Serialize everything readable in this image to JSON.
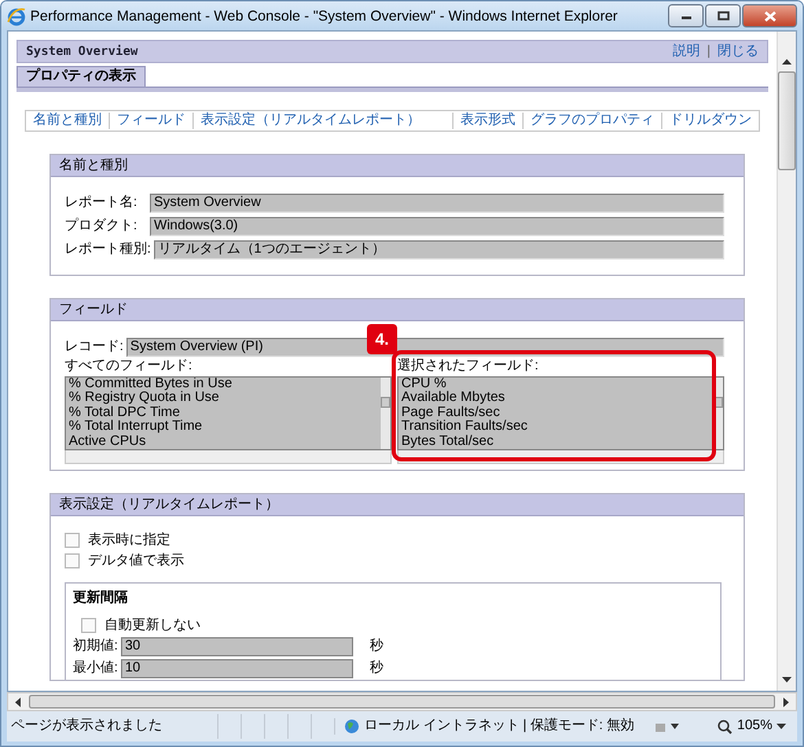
{
  "window": {
    "title": "Performance Management - Web Console - \"System Overview\" - Windows Internet Explorer"
  },
  "page_header": {
    "title": "System Overview",
    "links": [
      "説明",
      "閉じる"
    ],
    "link_separator": "|"
  },
  "tabs": [
    {
      "label": "プロパティの表示",
      "selected": true
    }
  ],
  "nav_links": [
    "名前と種別",
    "フィールド",
    "表示設定（リアルタイムレポート）",
    "表示形式",
    "グラフのプロパティ",
    "ドリルダウン"
  ],
  "sections": [
    {
      "kind": "form",
      "title": "名前と種別",
      "fields": [
        {
          "label": "レポート名:",
          "value": "System Overview"
        },
        {
          "label": "プロダクト:",
          "value": "Windows(3.0)"
        },
        {
          "label": "レポート種別:",
          "value": "リアルタイム（1つのエージェント）"
        }
      ]
    },
    {
      "kind": "fields",
      "title": "フィールド",
      "record": {
        "label": "レコード:",
        "value": "System Overview (PI)"
      },
      "all_fields": {
        "label": "すべてのフィールド:",
        "items": [
          "% Committed Bytes in Use",
          "% Registry Quota in Use",
          "% Total DPC Time",
          "% Total Interrupt Time",
          "Active CPUs"
        ]
      },
      "selected_fields": {
        "label": "選択されたフィールド:",
        "items": [
          "CPU %",
          "Available Mbytes",
          "Page Faults/sec",
          "Transition Faults/sec",
          "Bytes Total/sec"
        ]
      },
      "annotation": {
        "label": "4."
      }
    },
    {
      "kind": "display",
      "title": "表示設定（リアルタイムレポート）",
      "checkboxes": [
        {
          "label": "表示時に指定",
          "checked": false
        },
        {
          "label": "デルタ値で表示",
          "checked": false
        }
      ],
      "group": {
        "title": "更新間隔",
        "checkbox": {
          "label": "自動更新しない",
          "checked": false
        },
        "fields": [
          {
            "label": "初期値:",
            "value": "30",
            "unit": "秒"
          },
          {
            "label": "最小値:",
            "value": "10",
            "unit": "秒"
          }
        ]
      }
    }
  ],
  "status_bar": {
    "text": "ページが表示されました",
    "zone": "ローカル イントラネット | 保護モード: 無効",
    "zoom": "105%"
  }
}
